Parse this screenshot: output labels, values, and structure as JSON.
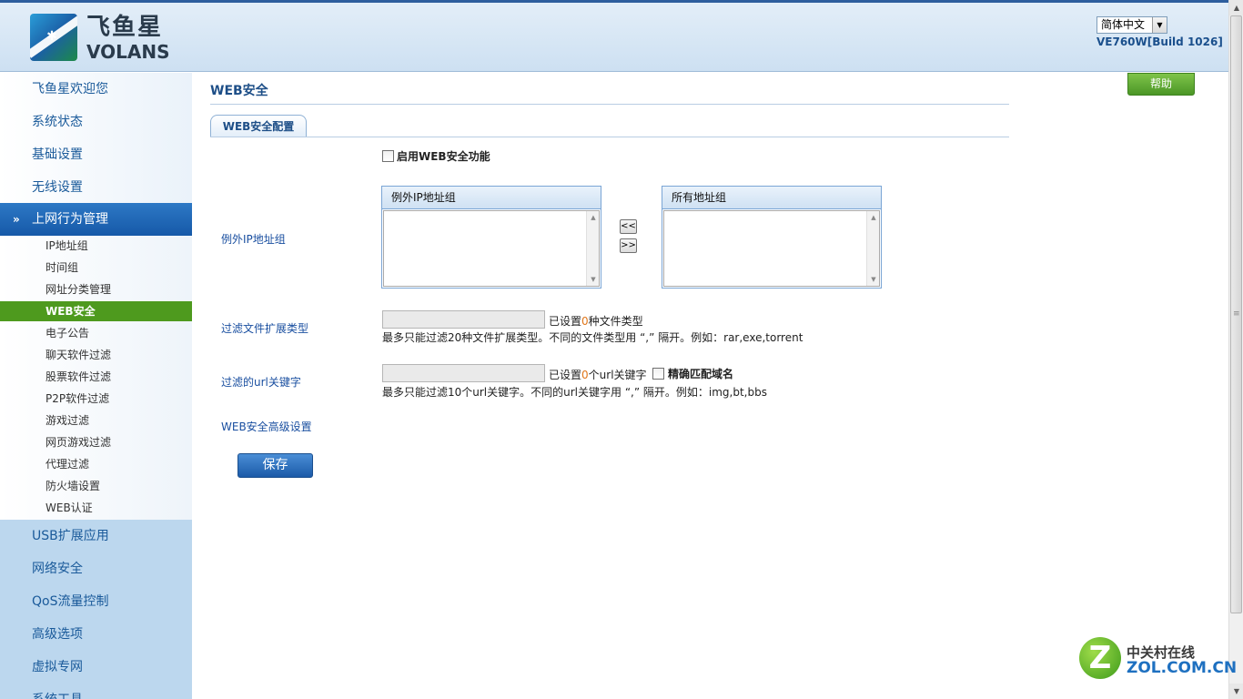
{
  "header": {
    "logo_cn": "飞鱼星",
    "logo_en": "VOLANS",
    "language": "简体中文",
    "build": "VE760W[Build 1026]"
  },
  "sidebar": {
    "top_items": [
      {
        "label": "飞鱼星欢迎您"
      },
      {
        "label": "系统状态"
      },
      {
        "label": "基础设置"
      },
      {
        "label": "无线设置"
      }
    ],
    "active_item": {
      "label": "上网行为管理"
    },
    "sub_items": [
      {
        "label": "IP地址组"
      },
      {
        "label": "时间组"
      },
      {
        "label": "网址分类管理"
      },
      {
        "label": "WEB安全",
        "selected": true
      },
      {
        "label": "电子公告"
      },
      {
        "label": "聊天软件过滤"
      },
      {
        "label": "股票软件过滤"
      },
      {
        "label": "P2P软件过滤"
      },
      {
        "label": "游戏过滤"
      },
      {
        "label": "网页游戏过滤"
      },
      {
        "label": "代理过滤"
      },
      {
        "label": "防火墙设置"
      },
      {
        "label": "WEB认证"
      }
    ],
    "bottom_items": [
      {
        "label": "USB扩展应用"
      },
      {
        "label": "网络安全"
      },
      {
        "label": "QoS流量控制"
      },
      {
        "label": "高级选项"
      },
      {
        "label": "虚拟专网"
      },
      {
        "label": "系统工具"
      }
    ]
  },
  "main": {
    "page_title": "WEB安全",
    "help_label": "帮助",
    "tab_label": "WEB安全配置",
    "enable_label": "启用WEB安全功能",
    "exception_ip_label": "例外IP地址组",
    "exception_list_header": "例外IP地址组",
    "all_list_header": "所有地址组",
    "move_left": "<<",
    "move_right": ">>",
    "file_ext_label": "过滤文件扩展类型",
    "file_ext_value": "",
    "file_ext_count_prefix": "已设置",
    "file_ext_count": "0",
    "file_ext_count_suffix": "种文件类型",
    "file_ext_hint": "最多只能过滤20种文件扩展类型。不同的文件类型用 “,” 隔开。例如：rar,exe,torrent",
    "url_kw_label": "过滤的url关键字",
    "url_kw_value": "",
    "url_kw_count_prefix": "已设置",
    "url_kw_count": "0",
    "url_kw_count_suffix": "个url关键字",
    "exact_match_label": "精确匹配域名",
    "url_kw_hint": "最多只能过滤10个url关键字。不同的url关键字用 “,” 隔开。例如：img,bt,bbs",
    "advanced_label": "WEB安全高级设置",
    "save_label": "保存"
  },
  "watermark": {
    "letter": "Z",
    "cn": "中关村在线",
    "en": "ZOL.COM.CN"
  },
  "colors": {
    "accent_blue": "#1659a8",
    "selected_green": "#4e9a1e",
    "count_orange": "#e0761a",
    "label_blue": "#1a4fa0"
  }
}
